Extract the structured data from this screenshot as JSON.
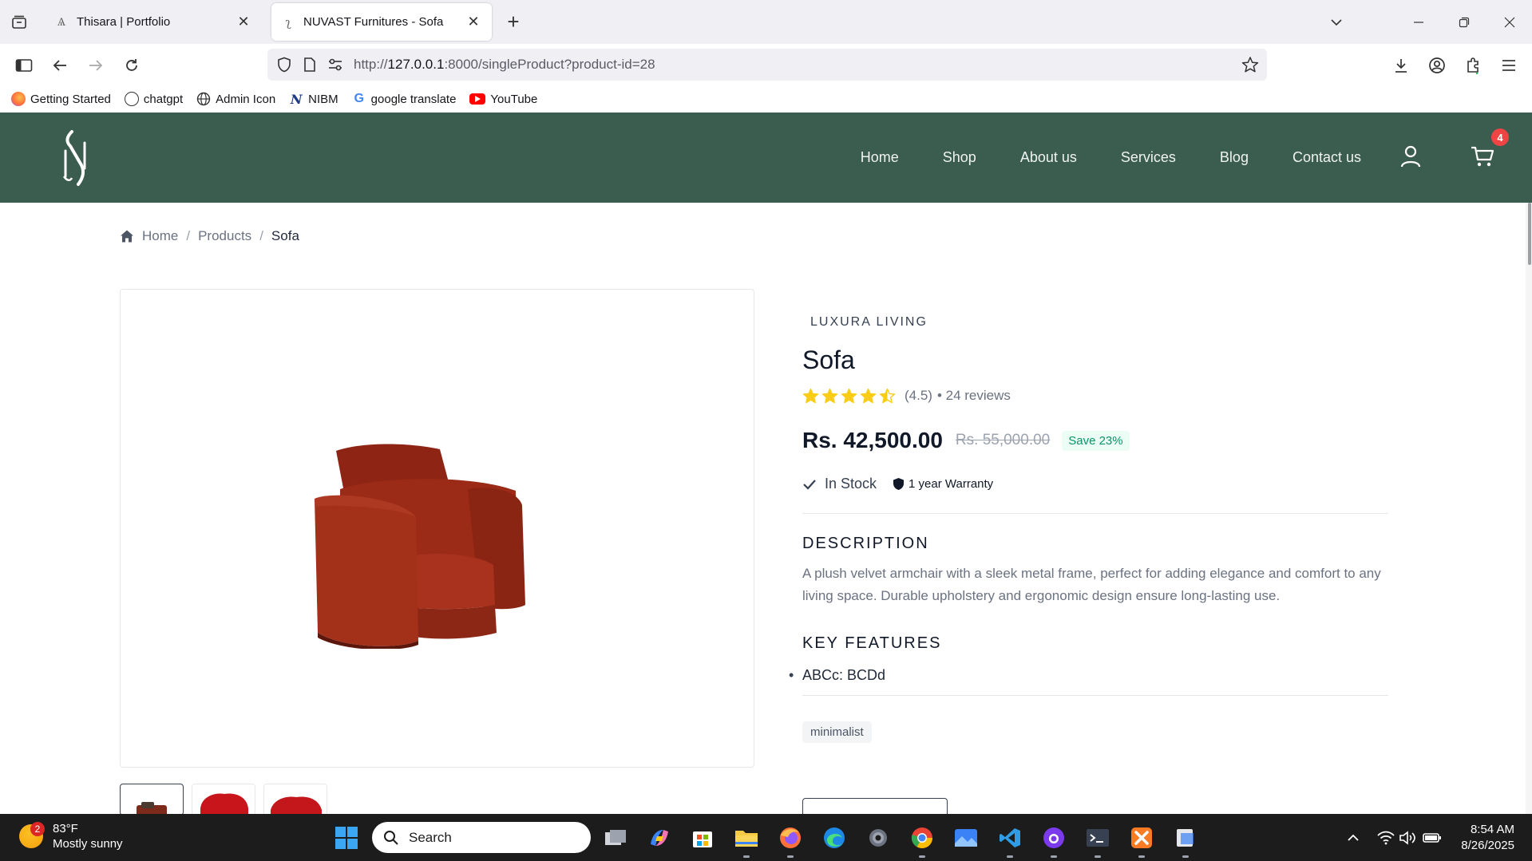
{
  "browser": {
    "tabs": [
      {
        "title": "Thisara | Portfolio",
        "active": false
      },
      {
        "title": "NUVAST Furnitures - Sofa",
        "active": true
      }
    ],
    "url_prefix": "http://",
    "url_host": "127.0.0.1",
    "url_rest": ":8000/singleProduct?product-id=28",
    "bookmarks": [
      {
        "label": "Getting Started",
        "icon": "firefox-icon"
      },
      {
        "label": "chatgpt",
        "icon": "chatgpt-icon"
      },
      {
        "label": "Admin Icon",
        "icon": "globe-icon"
      },
      {
        "label": "NIBM",
        "icon": "nibm-icon"
      },
      {
        "label": "google translate",
        "icon": "google-icon"
      },
      {
        "label": "YouTube",
        "icon": "youtube-icon"
      }
    ]
  },
  "site": {
    "nav": [
      "Home",
      "Shop",
      "About us",
      "Services",
      "Blog",
      "Contact us"
    ],
    "cart_count": "4",
    "header_color": "#3b5d50"
  },
  "breadcrumb": {
    "home": "Home",
    "products": "Products",
    "current": "Sofa"
  },
  "product": {
    "brand": "LUXURA LIVING",
    "title": "Sofa",
    "rating_value": 4.5,
    "rating_text": "(4.5)",
    "reviews_text": "• 24 reviews",
    "price": "Rs. 42,500.00",
    "old_price": "Rs. 55,000.00",
    "save_label": "Save 23%",
    "stock": "In Stock",
    "warranty": "1 year Warranty",
    "description_heading": "DESCRIPTION",
    "description": "A plush velvet armchair with a sleek metal frame, perfect for adding elegance and comfort to any living space. Durable upholstery and ergonomic design ensure long-lasting use.",
    "features_heading": "KEY FEATURES",
    "features": [
      "ABCc: BCDd"
    ],
    "tags": [
      "minimalist"
    ],
    "thumbnails": [
      "thumbnail-1",
      "thumbnail-2",
      "thumbnail-3"
    ]
  },
  "taskbar": {
    "weather_temp": "83°F",
    "weather_desc": "Mostly sunny",
    "weather_badge": "2",
    "search_placeholder": "Search",
    "time": "8:54 AM",
    "date": "8/26/2025"
  }
}
